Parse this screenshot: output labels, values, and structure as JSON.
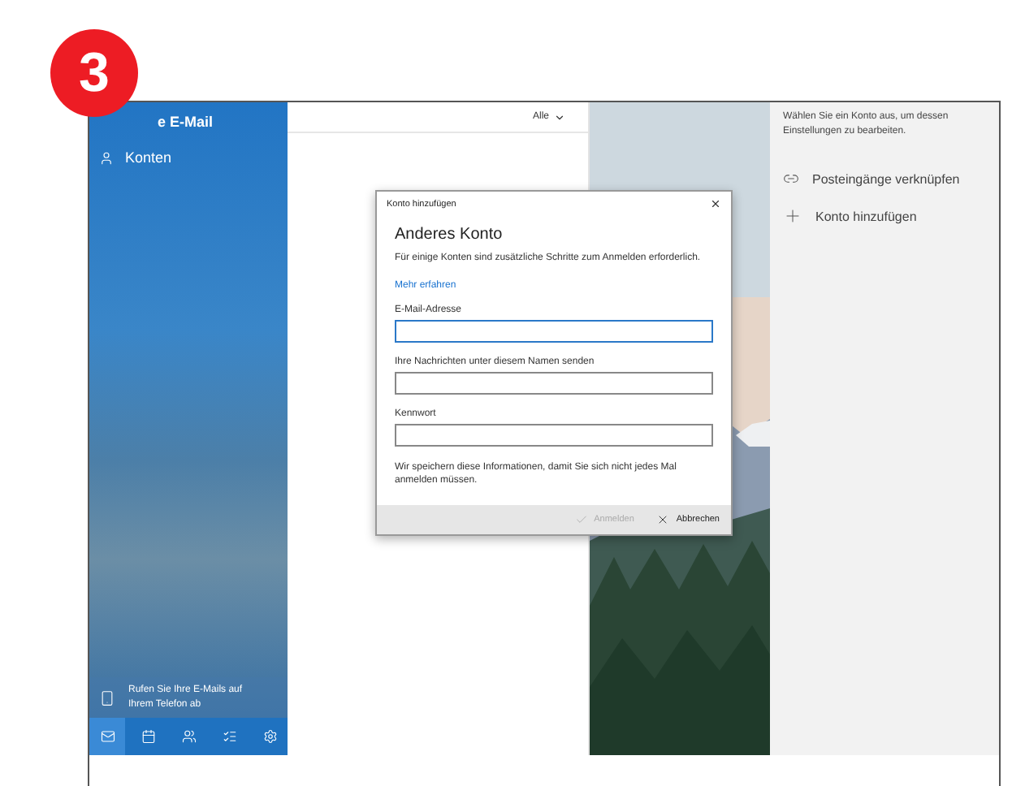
{
  "badge": "3",
  "app": {
    "title": "e E-Mail",
    "sidebar_items": [
      {
        "label": "Konten"
      }
    ],
    "phone_banner": "Rufen Sie Ihre E-Mails auf Ihrem Telefon ab",
    "nav_icons": [
      {
        "kind": "mail",
        "selected": true
      },
      {
        "kind": "calendar",
        "selected": false
      },
      {
        "kind": "people",
        "selected": false
      },
      {
        "kind": "todo",
        "selected": false
      },
      {
        "kind": "settings",
        "selected": false
      }
    ]
  },
  "list": {
    "filter": "Alle"
  },
  "settings": {
    "hint": "Wählen Sie ein Konto aus, um dessen Einstellungen zu bearbeiten.",
    "actions": [
      {
        "kind": "link",
        "label": "Posteingänge verknüpfen"
      },
      {
        "kind": "add",
        "label": "Konto hinzufügen"
      }
    ]
  },
  "dialog": {
    "title": "Konto hinzufügen",
    "heading": "Anderes Konto",
    "description": "Für einige Konten sind zusätzliche Schritte zum Anmelden erforderlich.",
    "link": "Mehr erfahren",
    "fields": [
      {
        "label": "E-Mail-Adresse",
        "focused": true
      },
      {
        "label": "Ihre Nachrichten unter diesem Namen senden",
        "focused": false
      },
      {
        "label": "Kennwort",
        "focused": false
      }
    ],
    "note": "Wir speichern diese Informationen, damit Sie sich nicht jedes Mal anmelden müssen.",
    "buttons": [
      {
        "kind": "confirm",
        "label": "Anmelden",
        "disabled": true
      },
      {
        "kind": "cancel",
        "label": "Abbrechen",
        "disabled": false
      }
    ]
  }
}
